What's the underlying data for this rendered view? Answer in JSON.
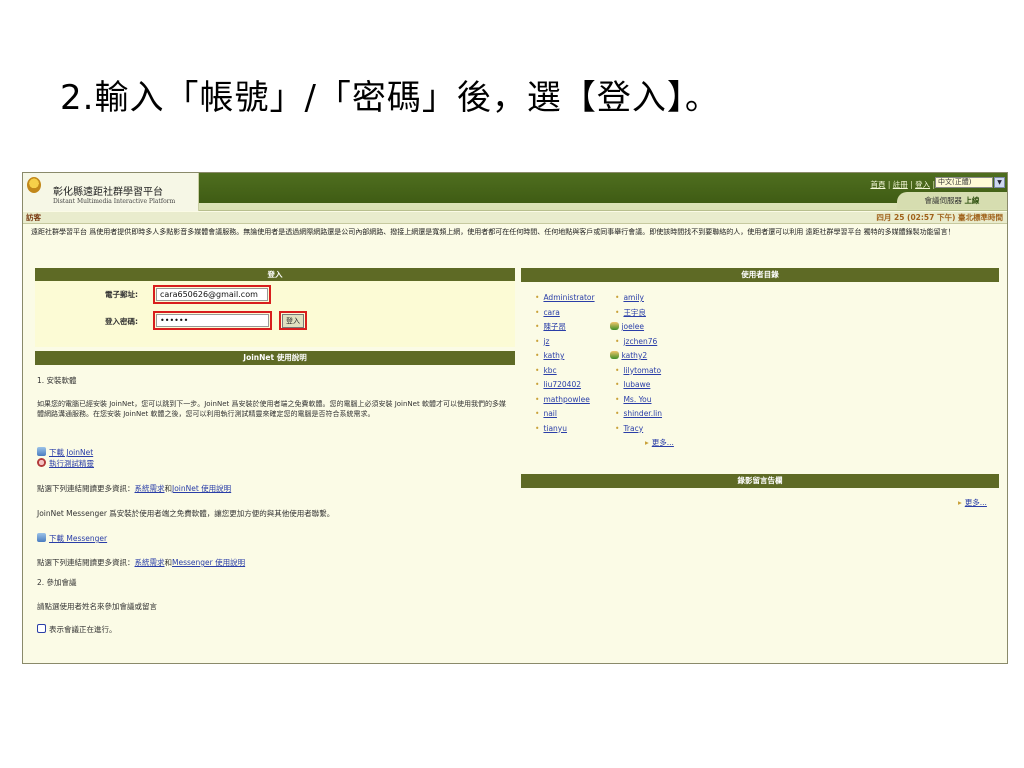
{
  "slide_title": "2.輸入「帳號」/「密碼」後，選【登入】。",
  "app": {
    "logo_title": "彰化縣遠距社群學習平台",
    "logo_subtitle": "Distant Multimedia Interactive Platform"
  },
  "header": {
    "links": [
      "首頁",
      "註冊",
      "登入"
    ],
    "separator": "|",
    "language_selected": "中文(正體)",
    "server_text": "會議伺服器",
    "server_status": "上線"
  },
  "guest_bar": {
    "label": "訪客",
    "datetime": "四月 25 (02:57 下午) 臺北標準時間"
  },
  "intro_text": "遠距社群學習平台 爲使用者提供即時多人多點影音多媒體會議服務。無論使用者是透過網際網路還是公司內部網路、撥接上網還是寬頻上網，使用者都可在任何時間、任何地點與客戶或同事舉行會議。即使該時間找不到要聯絡的人，使用者還可以利用 遠距社群學習平台 獨特的多媒體錄製功能留言！",
  "login": {
    "title": "登入",
    "email_label": "電子郵址:",
    "email_value": "cara650626@gmail.com",
    "password_label": "登入密碼:",
    "password_value": "••••••",
    "submit_label": "登入"
  },
  "joinnet": {
    "title": "JoinNet 使用說明",
    "step1": "1. 安裝軟體",
    "desc": "如果您的電腦已經安裝 JoinNet，您可以跳到下一步。JoinNet 爲安裝於使用者端之免費軟體。您的電腦上必須安裝 JoinNet 軟體才可以使用我們的多媒體網路溝通服務。在您安裝 JoinNet 軟體之後，您可以利用執行測試精靈來確定您的電腦是否符合系統需求。",
    "download_link": "下載 JoinNet",
    "test_link": "執行測試精靈",
    "more_info_prefix": "點選下列連結閱讀更多資訊：",
    "sysreq_link": "系統需求",
    "and1": "和",
    "joinnet_help_link": "JoinNet 使用說明",
    "messenger_desc": "JoinNet Messenger 爲安裝於使用者端之免費軟體，讓您更加方便的與其他使用者聯繫。",
    "download_messenger_link": "下載 Messenger",
    "more_info_prefix2": "點選下列連結閱讀更多資訊：",
    "sysreq_link2": "系統需求",
    "and2": "和",
    "messenger_help_link": "Messenger 使用說明",
    "step2": "2. 參加會議",
    "step2_desc": "請點選使用者姓名來參加會議或留言",
    "meeting_note": "表示會議正在進行。"
  },
  "user_directory": {
    "title": "使用者目錄",
    "col1": [
      "Administrator",
      "cara",
      "陳子昂",
      "jz",
      "kathy",
      "kbc",
      "liu720402",
      "mathpowlee",
      "nail",
      "tianyu"
    ],
    "col2": [
      "amily",
      "王宇良",
      "joelee",
      "jzchen76",
      "kathy2",
      "lilytomato",
      "lubawe",
      "Ms. You",
      "shinder.lin",
      "Tracy"
    ],
    "more": "更多..."
  },
  "recorded_messages": {
    "title": "錄影留言告欄",
    "more": "更多..."
  }
}
